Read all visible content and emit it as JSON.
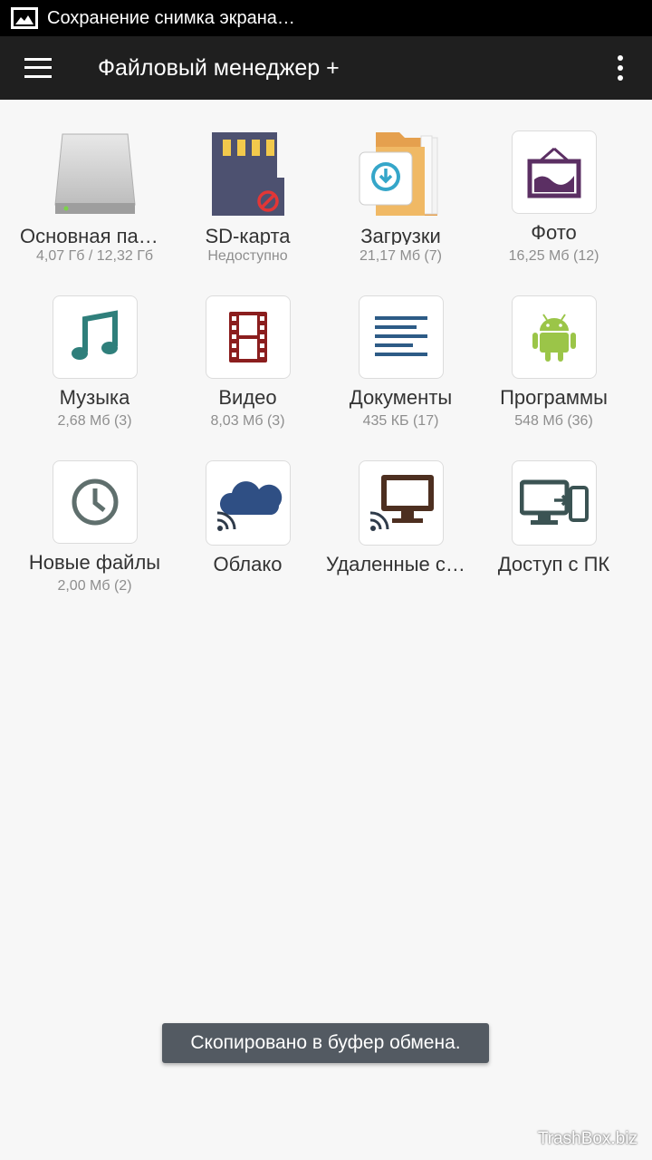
{
  "status_bar": {
    "notification_icon": "image-icon",
    "notification_text": "Сохранение снимка экрана…"
  },
  "app_bar": {
    "title": "Файловый менеджер +",
    "menu_icon": "hamburger-menu-icon",
    "overflow_icon": "more-vert-icon"
  },
  "tiles": [
    {
      "label": "Основная память",
      "subtitle": "4,07 Гб / 12,32 Гб",
      "icon": "hard-drive-icon"
    },
    {
      "label": "SD-карта",
      "subtitle": "Недоступно",
      "icon": "sd-card-icon"
    },
    {
      "label": "Загрузки",
      "subtitle": "21,17 Мб (7)",
      "icon": "downloads-folder-icon"
    },
    {
      "label": "Фото",
      "subtitle": "16,25 Мб (12)",
      "icon": "photo-frame-icon"
    },
    {
      "label": "Музыка",
      "subtitle": "2,68 Мб (3)",
      "icon": "music-note-icon"
    },
    {
      "label": "Видео",
      "subtitle": "8,03 Мб (3)",
      "icon": "film-strip-icon"
    },
    {
      "label": "Документы",
      "subtitle": "435 КБ (17)",
      "icon": "document-lines-icon"
    },
    {
      "label": "Программы",
      "subtitle": "548 Мб (36)",
      "icon": "android-icon"
    },
    {
      "label": "Новые файлы",
      "subtitle": "2,00 Мб (2)",
      "icon": "clock-icon"
    },
    {
      "label": "Облако",
      "subtitle": "",
      "icon": "cloud-icon"
    },
    {
      "label": "Удаленные службы",
      "subtitle": "",
      "icon": "remote-monitor-icon"
    },
    {
      "label": "Доступ с ПК",
      "subtitle": "",
      "icon": "pc-access-icon"
    }
  ],
  "toast": {
    "text": "Скопировано в буфер обмена."
  },
  "watermark": {
    "text": "TrashBox.biz"
  }
}
